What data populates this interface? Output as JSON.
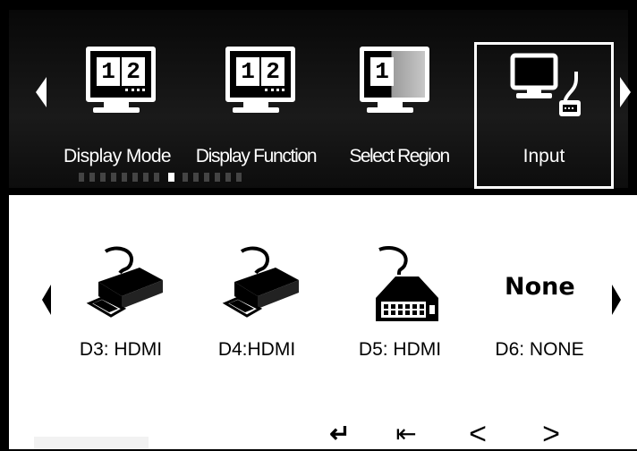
{
  "top_menu": {
    "items": [
      {
        "label": "Display Mode",
        "icon": "split-monitor-icon"
      },
      {
        "label": "Display Function",
        "icon": "split-monitor-icon"
      },
      {
        "label": "Select Region",
        "icon": "region-monitor-icon"
      },
      {
        "label": "Input",
        "icon": "computer-input-icon",
        "selected": true
      }
    ],
    "num1": "1",
    "num2": "2"
  },
  "inputs": {
    "items": [
      {
        "label": "D3: HDMI",
        "icon": "hdmi-connector-icon"
      },
      {
        "label": "D4:HDMI",
        "icon": "hdmi-connector-icon"
      },
      {
        "label": "D5: HDMI",
        "icon": "dvi-connector-icon"
      },
      {
        "label": "D6: NONE",
        "icon": "none-text"
      }
    ],
    "none_text": "None"
  },
  "bottom_buttons": {
    "enter": "↵",
    "exit": "⇤",
    "prev": "<",
    "next": ">"
  },
  "colors": {
    "background": "#000000",
    "panel": "#ffffff",
    "text_dark": "#000000",
    "text_light": "#ffffff"
  }
}
